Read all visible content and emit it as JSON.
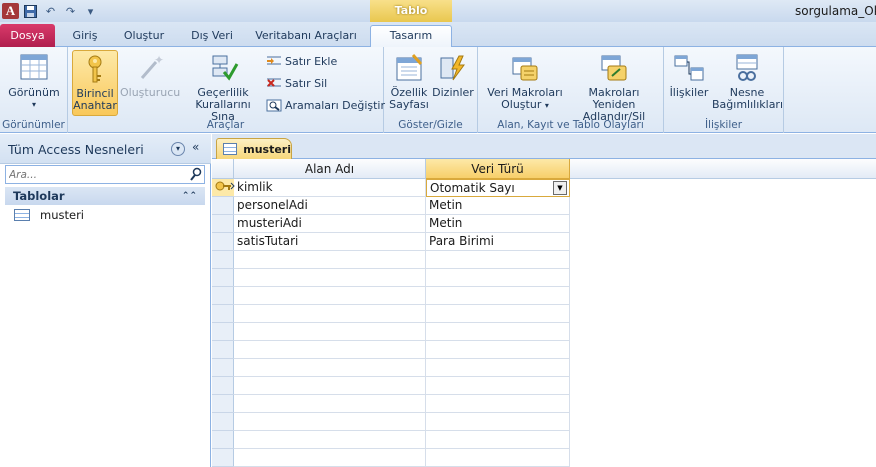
{
  "window": {
    "title": "sorgulama_Oka"
  },
  "qat": {
    "undo": "↶",
    "redo": "↷",
    "customize": "▾"
  },
  "contextual_group": "Tablo Araçları",
  "tabs": [
    {
      "label": "Dosya"
    },
    {
      "label": "Giriş"
    },
    {
      "label": "Oluştur"
    },
    {
      "label": "Dış Veri"
    },
    {
      "label": "Veritabanı Araçları"
    },
    {
      "label": "Tasarım"
    }
  ],
  "ribbon": {
    "gorunumler": {
      "label": "Görünümler",
      "gorunum": "Görünüm"
    },
    "araclar": {
      "label": "Araçlar",
      "birincil_anahtar_1": "Birincil",
      "birincil_anahtar_2": "Anahtar",
      "olusturucu": "Oluşturucu",
      "gecerlilik_1": "Geçerlilik",
      "gecerlilik_2": "Kurallarını Sına",
      "satir_ekle": "Satır Ekle",
      "satir_sil": "Satır Sil",
      "aramalari_degistir": "Aramaları Değiştir"
    },
    "goster_gizle": {
      "label": "Göster/Gizle",
      "ozellik_1": "Özellik",
      "ozellik_2": "Sayfası",
      "dizinler": "Dizinler"
    },
    "olaylar": {
      "label": "Alan, Kayıt ve Tablo Olayları",
      "veri_makrolari_1": "Veri Makroları",
      "veri_makrolari_2": "Oluştur",
      "yeniden_adlandir_1": "Makroları Yeniden",
      "yeniden_adlandir_2": "Adlandır/Sil"
    },
    "iliskiler": {
      "label": "İlişkiler",
      "iliskiler": "İlişkiler",
      "nesne_1": "Nesne",
      "nesne_2": "Bağımlılıkları"
    }
  },
  "nav": {
    "title": "Tüm Access Nesneleri",
    "search_placeholder": "Ara...",
    "group": "Tablolar",
    "items": [
      {
        "label": "musteri"
      }
    ]
  },
  "doc": {
    "tab": "musteri",
    "columns": [
      "Alan Adı",
      "Veri Türü"
    ],
    "rows": [
      {
        "field": "kimlik",
        "type": "Otomatik Sayı"
      },
      {
        "field": "personelAdi",
        "type": "Metin"
      },
      {
        "field": "musteriAdi",
        "type": "Metin"
      },
      {
        "field": "satisTutari",
        "type": "Para Birimi"
      }
    ]
  }
}
